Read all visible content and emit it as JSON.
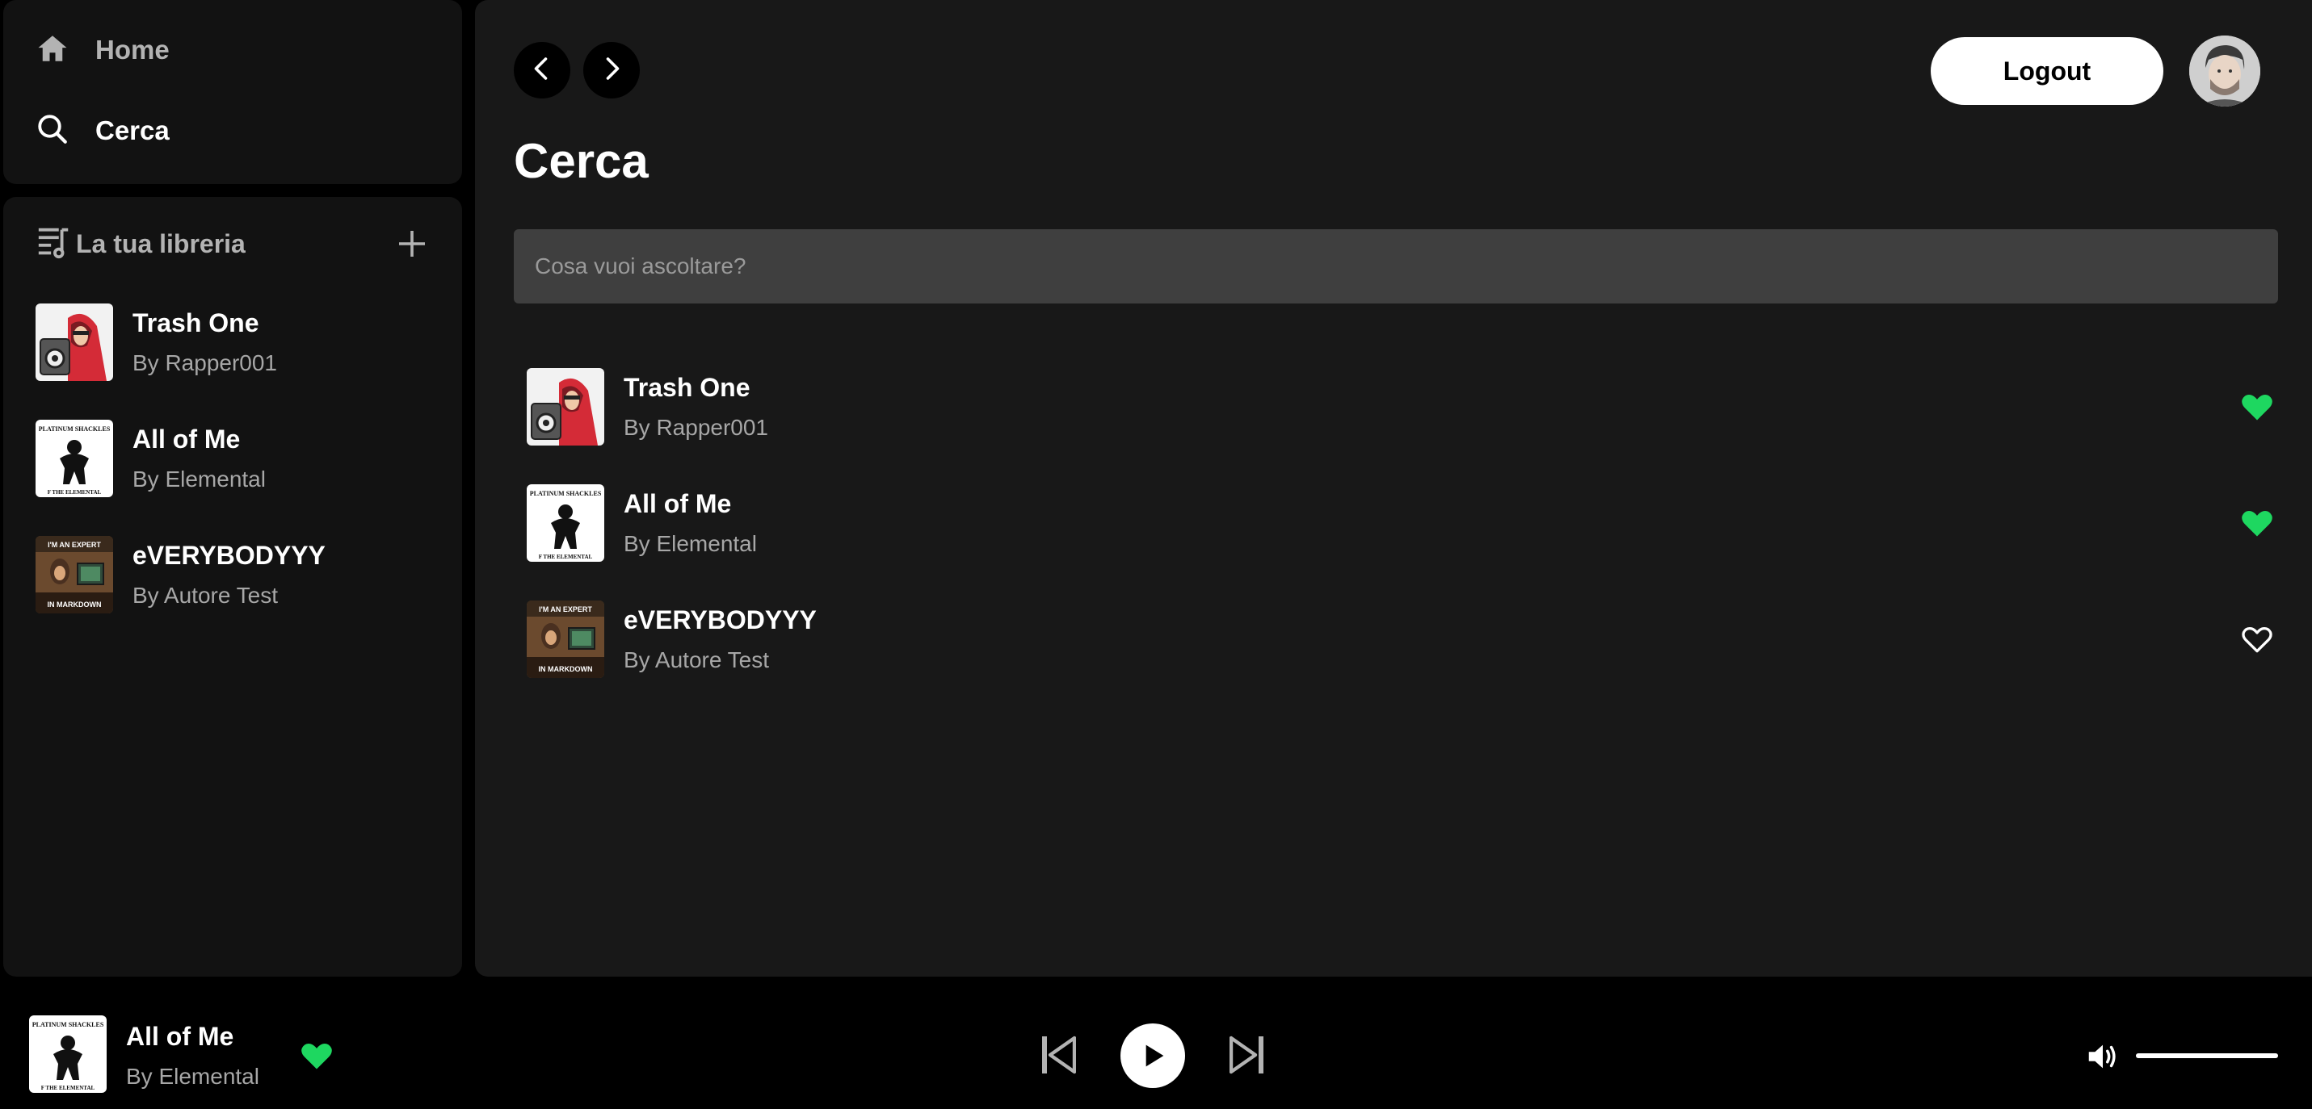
{
  "nav": {
    "home_label": "Home",
    "search_label": "Cerca"
  },
  "library": {
    "title": "La tua libreria",
    "items": [
      {
        "title": "Trash One",
        "artist": "By Rapper001"
      },
      {
        "title": "All of Me",
        "artist": "By Elemental"
      },
      {
        "title": "eVERYBODYYY",
        "artist": "By Autore Test"
      }
    ]
  },
  "header": {
    "logout_label": "Logout"
  },
  "main": {
    "page_title": "Cerca",
    "search_placeholder": "Cosa vuoi ascoltare?",
    "results": [
      {
        "title": "Trash One",
        "artist": "By Rapper001",
        "liked": true
      },
      {
        "title": "All of Me",
        "artist": "By Elemental",
        "liked": true
      },
      {
        "title": "eVERYBODYYY",
        "artist": "By Autore Test",
        "liked": false
      }
    ]
  },
  "cover_art": {
    "all_of_me_top": "PLATINUM SHACKLES",
    "all_of_me_bottom": "F THE ELEMENTAL",
    "everybody_top": "I'M AN EXPERT",
    "everybody_bottom": "IN MARKDOWN"
  },
  "player": {
    "now_playing_title": "All of Me",
    "now_playing_artist": "By Elemental",
    "liked": true,
    "volume": 1.0
  },
  "colors": {
    "accent": "#1ed760",
    "panel": "#121212",
    "main_bg": "#181818",
    "search_bg": "#3f3f3f",
    "secondary_text": "#a7a7a7"
  }
}
